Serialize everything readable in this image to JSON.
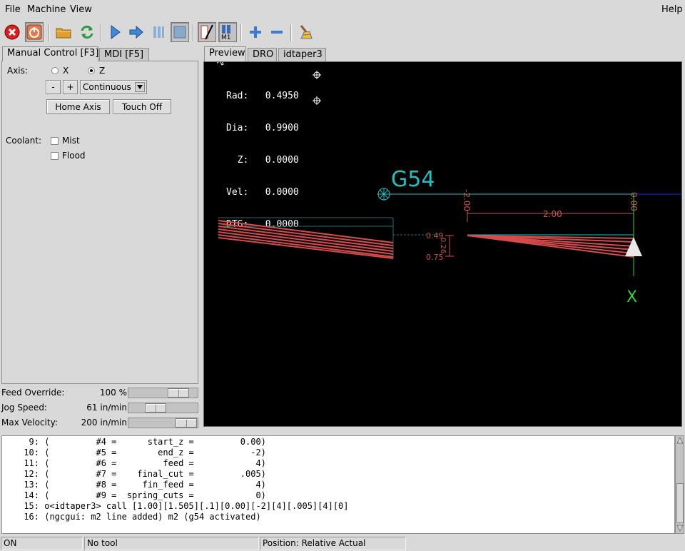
{
  "menubar": {
    "file": "File",
    "machine": "Machine",
    "view": "View",
    "help": "Help"
  },
  "toolbar": {
    "buttons": [
      "estop-icon",
      "power-icon",
      "open-folder-icon",
      "reload-icon",
      "run-icon",
      "step-icon",
      "pause-icon",
      "stop-icon",
      "block-delete-icon",
      "optional-stop-icon",
      "zoom-in-icon",
      "zoom-out-icon",
      "clear-plot-icon"
    ],
    "optional_stop_label": "M1"
  },
  "left_tabs": [
    "Manual Control [F3]",
    "MDI [F5]"
  ],
  "manual": {
    "axis_label": "Axis:",
    "axis_x": "X",
    "axis_z": "Z",
    "selected_axis": "Z",
    "minus": "-",
    "plus": "+",
    "jog_mode": "Continuous",
    "home_axis": "Home Axis",
    "touch_off": "Touch Off",
    "coolant_label": "Coolant:",
    "mist": "Mist",
    "flood": "Flood"
  },
  "sliders": [
    {
      "label": "Feed Override:",
      "value": "100 %",
      "position": 0.82
    },
    {
      "label": "Jog Speed:",
      "value": "61 in/min",
      "position": 0.35
    },
    {
      "label": "Max Velocity:",
      "value": "200 in/min",
      "position": 0.98
    }
  ],
  "right_tabs": [
    "Preview",
    "DRO",
    "idtaper3"
  ],
  "dro": [
    {
      "label": "Rad:",
      "value": "0.4950"
    },
    {
      "label": "Dia:",
      "value": "0.9900"
    },
    {
      "label": "  Z:",
      "value": "0.0000"
    },
    {
      "label": "Vel:",
      "value": "0.0000"
    },
    {
      "label": "DTG:",
      "value": "0.0000"
    }
  ],
  "preview": {
    "coord_system": "G54",
    "dim_z_left": "-2.00",
    "dim_z_right": "0.00",
    "dim_length": "2.00",
    "dim_x_top": "0.49",
    "dim_x_mid": "0.26",
    "dim_x_bottom": "0.75",
    "axis_x": "X",
    "colors": {
      "feed": "#d64b4b",
      "axis": "#20c0c0",
      "dim": "#d05050",
      "x_axis": "#30d030",
      "z_axis": "#2020ff"
    }
  },
  "gcode": [
    {
      "num": "9:",
      "text": "(         #4 =      start_z =         0.00)"
    },
    {
      "num": "10:",
      "text": "(         #5 =        end_z =           -2)"
    },
    {
      "num": "11:",
      "text": "(         #6 =         feed =            4)"
    },
    {
      "num": "12:",
      "text": "(         #7 =    final_cut =         .005)"
    },
    {
      "num": "13:",
      "text": "(         #8 =     fin_feed =            4)"
    },
    {
      "num": "14:",
      "text": "(         #9 =  spring_cuts =            0)"
    },
    {
      "num": "15:",
      "text": "o<idtaper3> call [1.00][1.505][.1][0.00][-2][4][.005][4][0]"
    },
    {
      "num": "16:",
      "text": "(ngcgui: m2 line added) m2 (g54 activated)"
    }
  ],
  "status": {
    "state": "ON",
    "tool": "No tool",
    "position": "Position: Relative Actual"
  }
}
